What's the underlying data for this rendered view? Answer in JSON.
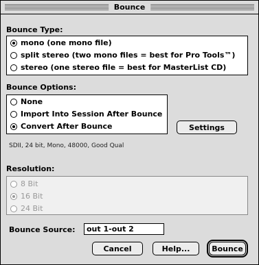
{
  "window": {
    "title": "Bounce"
  },
  "bounce_type": {
    "label": "Bounce Type:",
    "options": [
      {
        "label": "mono (one mono file)",
        "selected": true
      },
      {
        "label": "split stereo (two mono files = best for Pro Tools™)",
        "selected": false
      },
      {
        "label": "stereo (one stereo file = best for MasterList CD)",
        "selected": false
      }
    ]
  },
  "bounce_options": {
    "label": "Bounce Options:",
    "options": [
      {
        "label": "None",
        "selected": false
      },
      {
        "label": "Import Into Session After Bounce",
        "selected": false
      },
      {
        "label": "Convert After Bounce",
        "selected": true
      }
    ],
    "settings_button": "Settings",
    "info": "SDII, 24 bit, Mono, 48000, Good Qual"
  },
  "resolution": {
    "label": "Resolution:",
    "options": [
      {
        "label": "8 Bit",
        "selected": false
      },
      {
        "label": "16 Bit",
        "selected": true
      },
      {
        "label": "24 Bit",
        "selected": false
      }
    ]
  },
  "bounce_source": {
    "label": "Bounce Source:",
    "value": "out 1-out 2"
  },
  "buttons": {
    "cancel": "Cancel",
    "help": "Help...",
    "bounce": "Bounce"
  }
}
